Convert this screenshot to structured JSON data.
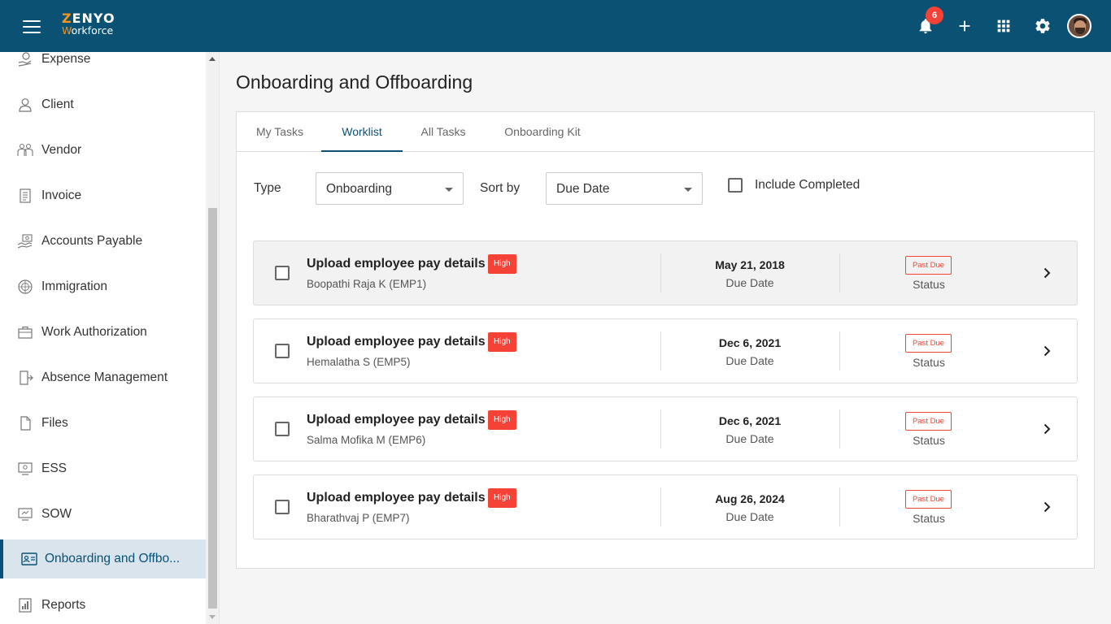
{
  "header": {
    "logo_top": "ZENYO",
    "logo_bottom": "Workforce",
    "notification_count": "6"
  },
  "sidebar": {
    "items": [
      {
        "label": "Expense",
        "icon": "expense-icon"
      },
      {
        "label": "Client",
        "icon": "client-icon"
      },
      {
        "label": "Vendor",
        "icon": "vendor-icon"
      },
      {
        "label": "Invoice",
        "icon": "invoice-icon"
      },
      {
        "label": "Accounts Payable",
        "icon": "accounts-payable-icon"
      },
      {
        "label": "Immigration",
        "icon": "immigration-icon"
      },
      {
        "label": "Work Authorization",
        "icon": "work-authorization-icon"
      },
      {
        "label": "Absence Management",
        "icon": "absence-management-icon"
      },
      {
        "label": "Files",
        "icon": "files-icon"
      },
      {
        "label": "ESS",
        "icon": "ess-icon"
      },
      {
        "label": "SOW",
        "icon": "sow-icon"
      },
      {
        "label": "Onboarding and Offbo...",
        "icon": "onboarding-icon",
        "active": true
      },
      {
        "label": "Reports",
        "icon": "reports-icon"
      }
    ]
  },
  "main": {
    "title": "Onboarding and Offboarding",
    "tabs": [
      {
        "label": "My Tasks"
      },
      {
        "label": "Worklist",
        "active": true
      },
      {
        "label": "All Tasks"
      },
      {
        "label": "Onboarding Kit"
      }
    ],
    "filters": {
      "type_label": "Type",
      "type_value": "Onboarding",
      "sort_label": "Sort by",
      "sort_value": "Due Date",
      "include_completed_label": "Include Completed",
      "include_completed_checked": false
    },
    "tasks": [
      {
        "title": "Upload employee pay details",
        "priority": "High",
        "employee": "Boopathi Raja K (EMP1)",
        "due_date": "May 21, 2018",
        "due_label": "Due Date",
        "status": "Past Due",
        "status_label": "Status"
      },
      {
        "title": "Upload employee pay details",
        "priority": "High",
        "employee": "Hemalatha S (EMP5)",
        "due_date": "Dec 6, 2021",
        "due_label": "Due Date",
        "status": "Past Due",
        "status_label": "Status"
      },
      {
        "title": "Upload employee pay details",
        "priority": "High",
        "employee": "Salma Mofika M (EMP6)",
        "due_date": "Dec 6, 2021",
        "due_label": "Due Date",
        "status": "Past Due",
        "status_label": "Status"
      },
      {
        "title": "Upload employee pay details",
        "priority": "High",
        "employee": "Bharathvaj P (EMP7)",
        "due_date": "Aug 26, 2024",
        "due_label": "Due Date",
        "status": "Past Due",
        "status_label": "Status"
      }
    ]
  },
  "colors": {
    "header_bg": "#0a5174",
    "accent": "#0a5174",
    "priority_high": "#f44336",
    "past_due": "#f44336",
    "logo_orange": "#f7941d"
  }
}
